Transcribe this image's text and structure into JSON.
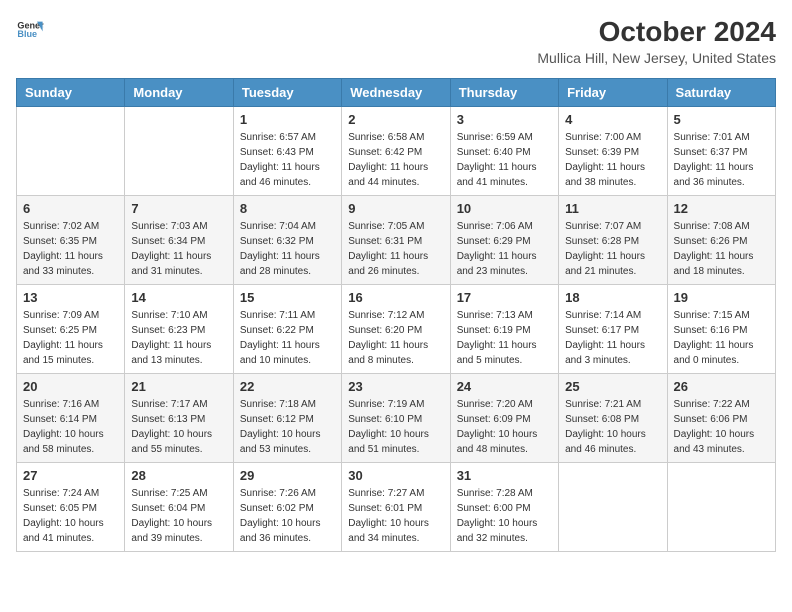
{
  "header": {
    "logo_line1": "General",
    "logo_line2": "Blue",
    "title": "October 2024",
    "location": "Mullica Hill, New Jersey, United States"
  },
  "days_of_week": [
    "Sunday",
    "Monday",
    "Tuesday",
    "Wednesday",
    "Thursday",
    "Friday",
    "Saturday"
  ],
  "weeks": [
    [
      {
        "day": "",
        "sunrise": "",
        "sunset": "",
        "daylight": ""
      },
      {
        "day": "",
        "sunrise": "",
        "sunset": "",
        "daylight": ""
      },
      {
        "day": "1",
        "sunrise": "Sunrise: 6:57 AM",
        "sunset": "Sunset: 6:43 PM",
        "daylight": "Daylight: 11 hours and 46 minutes."
      },
      {
        "day": "2",
        "sunrise": "Sunrise: 6:58 AM",
        "sunset": "Sunset: 6:42 PM",
        "daylight": "Daylight: 11 hours and 44 minutes."
      },
      {
        "day": "3",
        "sunrise": "Sunrise: 6:59 AM",
        "sunset": "Sunset: 6:40 PM",
        "daylight": "Daylight: 11 hours and 41 minutes."
      },
      {
        "day": "4",
        "sunrise": "Sunrise: 7:00 AM",
        "sunset": "Sunset: 6:39 PM",
        "daylight": "Daylight: 11 hours and 38 minutes."
      },
      {
        "day": "5",
        "sunrise": "Sunrise: 7:01 AM",
        "sunset": "Sunset: 6:37 PM",
        "daylight": "Daylight: 11 hours and 36 minutes."
      }
    ],
    [
      {
        "day": "6",
        "sunrise": "Sunrise: 7:02 AM",
        "sunset": "Sunset: 6:35 PM",
        "daylight": "Daylight: 11 hours and 33 minutes."
      },
      {
        "day": "7",
        "sunrise": "Sunrise: 7:03 AM",
        "sunset": "Sunset: 6:34 PM",
        "daylight": "Daylight: 11 hours and 31 minutes."
      },
      {
        "day": "8",
        "sunrise": "Sunrise: 7:04 AM",
        "sunset": "Sunset: 6:32 PM",
        "daylight": "Daylight: 11 hours and 28 minutes."
      },
      {
        "day": "9",
        "sunrise": "Sunrise: 7:05 AM",
        "sunset": "Sunset: 6:31 PM",
        "daylight": "Daylight: 11 hours and 26 minutes."
      },
      {
        "day": "10",
        "sunrise": "Sunrise: 7:06 AM",
        "sunset": "Sunset: 6:29 PM",
        "daylight": "Daylight: 11 hours and 23 minutes."
      },
      {
        "day": "11",
        "sunrise": "Sunrise: 7:07 AM",
        "sunset": "Sunset: 6:28 PM",
        "daylight": "Daylight: 11 hours and 21 minutes."
      },
      {
        "day": "12",
        "sunrise": "Sunrise: 7:08 AM",
        "sunset": "Sunset: 6:26 PM",
        "daylight": "Daylight: 11 hours and 18 minutes."
      }
    ],
    [
      {
        "day": "13",
        "sunrise": "Sunrise: 7:09 AM",
        "sunset": "Sunset: 6:25 PM",
        "daylight": "Daylight: 11 hours and 15 minutes."
      },
      {
        "day": "14",
        "sunrise": "Sunrise: 7:10 AM",
        "sunset": "Sunset: 6:23 PM",
        "daylight": "Daylight: 11 hours and 13 minutes."
      },
      {
        "day": "15",
        "sunrise": "Sunrise: 7:11 AM",
        "sunset": "Sunset: 6:22 PM",
        "daylight": "Daylight: 11 hours and 10 minutes."
      },
      {
        "day": "16",
        "sunrise": "Sunrise: 7:12 AM",
        "sunset": "Sunset: 6:20 PM",
        "daylight": "Daylight: 11 hours and 8 minutes."
      },
      {
        "day": "17",
        "sunrise": "Sunrise: 7:13 AM",
        "sunset": "Sunset: 6:19 PM",
        "daylight": "Daylight: 11 hours and 5 minutes."
      },
      {
        "day": "18",
        "sunrise": "Sunrise: 7:14 AM",
        "sunset": "Sunset: 6:17 PM",
        "daylight": "Daylight: 11 hours and 3 minutes."
      },
      {
        "day": "19",
        "sunrise": "Sunrise: 7:15 AM",
        "sunset": "Sunset: 6:16 PM",
        "daylight": "Daylight: 11 hours and 0 minutes."
      }
    ],
    [
      {
        "day": "20",
        "sunrise": "Sunrise: 7:16 AM",
        "sunset": "Sunset: 6:14 PM",
        "daylight": "Daylight: 10 hours and 58 minutes."
      },
      {
        "day": "21",
        "sunrise": "Sunrise: 7:17 AM",
        "sunset": "Sunset: 6:13 PM",
        "daylight": "Daylight: 10 hours and 55 minutes."
      },
      {
        "day": "22",
        "sunrise": "Sunrise: 7:18 AM",
        "sunset": "Sunset: 6:12 PM",
        "daylight": "Daylight: 10 hours and 53 minutes."
      },
      {
        "day": "23",
        "sunrise": "Sunrise: 7:19 AM",
        "sunset": "Sunset: 6:10 PM",
        "daylight": "Daylight: 10 hours and 51 minutes."
      },
      {
        "day": "24",
        "sunrise": "Sunrise: 7:20 AM",
        "sunset": "Sunset: 6:09 PM",
        "daylight": "Daylight: 10 hours and 48 minutes."
      },
      {
        "day": "25",
        "sunrise": "Sunrise: 7:21 AM",
        "sunset": "Sunset: 6:08 PM",
        "daylight": "Daylight: 10 hours and 46 minutes."
      },
      {
        "day": "26",
        "sunrise": "Sunrise: 7:22 AM",
        "sunset": "Sunset: 6:06 PM",
        "daylight": "Daylight: 10 hours and 43 minutes."
      }
    ],
    [
      {
        "day": "27",
        "sunrise": "Sunrise: 7:24 AM",
        "sunset": "Sunset: 6:05 PM",
        "daylight": "Daylight: 10 hours and 41 minutes."
      },
      {
        "day": "28",
        "sunrise": "Sunrise: 7:25 AM",
        "sunset": "Sunset: 6:04 PM",
        "daylight": "Daylight: 10 hours and 39 minutes."
      },
      {
        "day": "29",
        "sunrise": "Sunrise: 7:26 AM",
        "sunset": "Sunset: 6:02 PM",
        "daylight": "Daylight: 10 hours and 36 minutes."
      },
      {
        "day": "30",
        "sunrise": "Sunrise: 7:27 AM",
        "sunset": "Sunset: 6:01 PM",
        "daylight": "Daylight: 10 hours and 34 minutes."
      },
      {
        "day": "31",
        "sunrise": "Sunrise: 7:28 AM",
        "sunset": "Sunset: 6:00 PM",
        "daylight": "Daylight: 10 hours and 32 minutes."
      },
      {
        "day": "",
        "sunrise": "",
        "sunset": "",
        "daylight": ""
      },
      {
        "day": "",
        "sunrise": "",
        "sunset": "",
        "daylight": ""
      }
    ]
  ]
}
